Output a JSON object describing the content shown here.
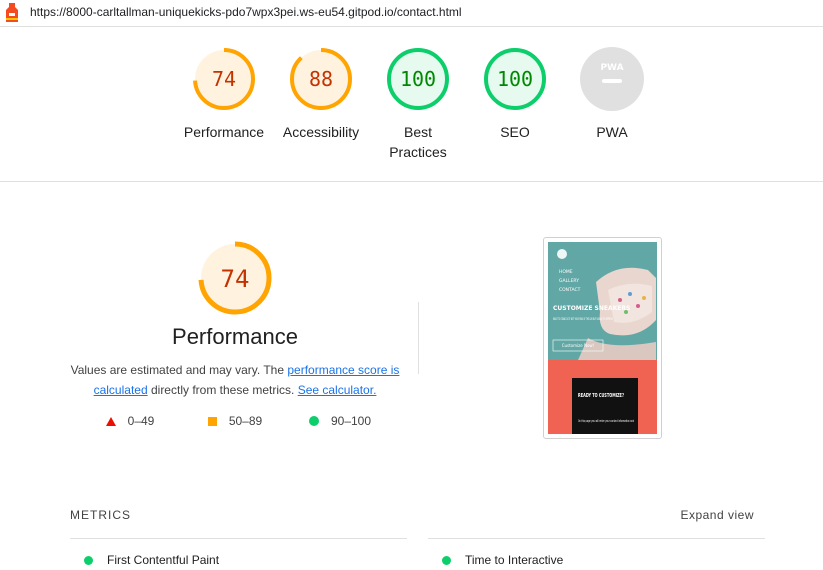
{
  "browser": {
    "url": "https://8000-carltallman-uniquekicks-pdo7wpx3pei.ws-eu54.gitpod.io/contact.html"
  },
  "gauges": [
    {
      "score": "74",
      "label": "Performance",
      "fill": 0.74,
      "color": "#ffa400",
      "text_color": "#c33300",
      "bg": "#fff3e0"
    },
    {
      "score": "88",
      "label": "Accessibility",
      "fill": 0.88,
      "color": "#ffa400",
      "text_color": "#c33300",
      "bg": "#fff3e0"
    },
    {
      "score": "100",
      "label": "Best\nPractices",
      "fill": 1.0,
      "color": "#0cce6b",
      "text_color": "#008800",
      "bg": "#e6faf0"
    },
    {
      "score": "100",
      "label": "SEO",
      "fill": 1.0,
      "color": "#0cce6b",
      "text_color": "#008800",
      "bg": "#e6faf0"
    },
    {
      "score": "",
      "label": "PWA",
      "fill": 0,
      "color": "#cccccc",
      "text_color": "#ffffff",
      "bg": "#e0e0e0",
      "badge": "PWA"
    }
  ],
  "performance": {
    "score": "74",
    "fill": 0.74,
    "title": "Performance",
    "desc_1": "Values are estimated and may vary. The ",
    "link_score": "performance score is calculated",
    "desc_2": " directly from these metrics. ",
    "link_calc": "See calculator.",
    "legend": [
      {
        "range": "0–49",
        "icon": "triangle-icon"
      },
      {
        "range": "50–89",
        "icon": "square-icon"
      },
      {
        "range": "90–100",
        "icon": "circle-icon"
      }
    ]
  },
  "screenshot": {
    "nav": [
      "HOME",
      "GALLERY",
      "CONTACT"
    ],
    "headline": "CUSTOMIZE SNEAKERS",
    "subtext": "WANT TO STAND OUT? NOT YOUR FIND OF THE DAY BUT UNIQUE TO IMPRESS!",
    "cta": "Customize Now!",
    "box_title": "READY TO CUSTOMIZE?",
    "box_text": "On this page you will enter your contact information and"
  },
  "metrics": {
    "heading": "METRICS",
    "expand": "Expand view",
    "items": [
      "First Contentful Paint",
      "Time to Interactive"
    ]
  }
}
